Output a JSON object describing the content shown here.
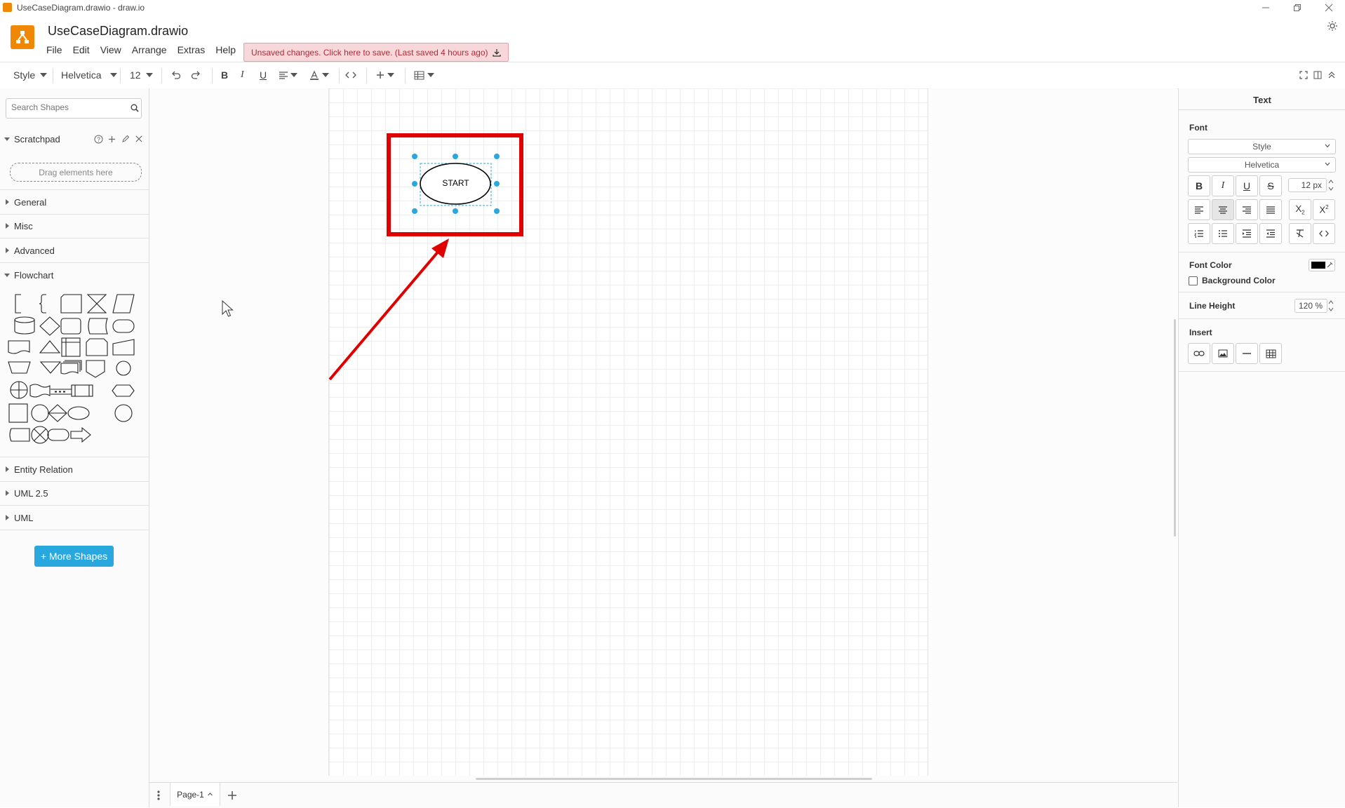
{
  "window": {
    "title": "UseCaseDiagram.drawio - draw.io",
    "controls": [
      "minimize",
      "restore",
      "close"
    ]
  },
  "header": {
    "file_title": "UseCaseDiagram.drawio",
    "menu": [
      "File",
      "Edit",
      "View",
      "Arrange",
      "Extras",
      "Help"
    ],
    "unsaved_notice": "Unsaved changes. Click here to save. (Last saved 4 hours ago)"
  },
  "toolbar": {
    "style": "Style",
    "font": "Helvetica",
    "size": "12"
  },
  "sidebar": {
    "search_placeholder": "Search Shapes",
    "scratchpad": "Scratchpad",
    "drag_hint": "Drag elements here",
    "sections": {
      "general": "General",
      "misc": "Misc",
      "advanced": "Advanced",
      "flowchart": "Flowchart",
      "entity": "Entity Relation",
      "uml25": "UML 2.5",
      "uml": "UML"
    },
    "more_shapes": "+ More Shapes"
  },
  "canvas": {
    "shape_label": "START",
    "highlight_color": "#e00000",
    "selection_color": "#29a8e0"
  },
  "format_panel": {
    "tab": "Text",
    "font_heading": "Font",
    "style_select": "Style",
    "font_select": "Helvetica",
    "font_size": "12 px",
    "font_color_label": "Font Color",
    "background_color_label": "Background Color",
    "line_height_label": "Line Height",
    "line_height": "120 %",
    "insert_heading": "Insert"
  },
  "footer": {
    "page_tab": "Page-1"
  },
  "colors": {
    "accent": "#29a8e0",
    "logo": "#f08705",
    "unsaved_bg": "#f8d7da",
    "unsaved_text": "#b02a37"
  }
}
